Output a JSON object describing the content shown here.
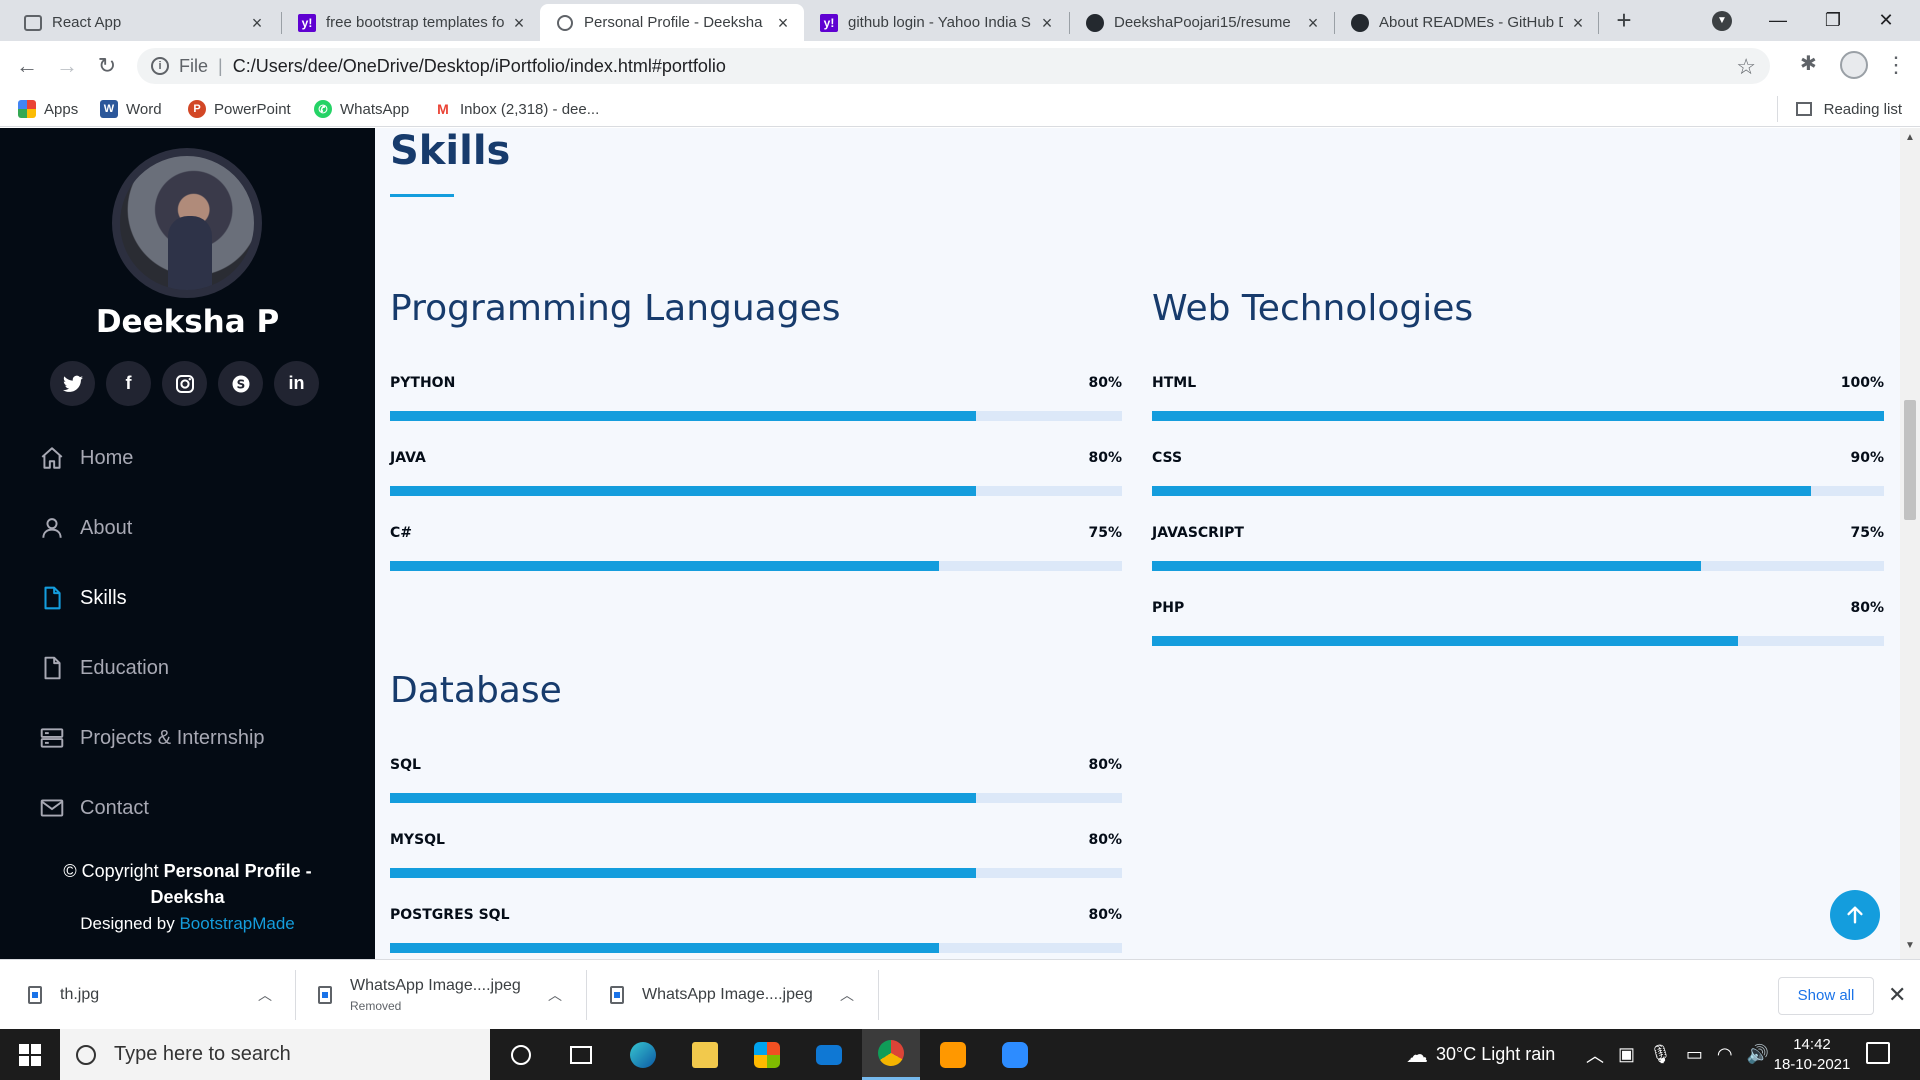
{
  "browser": {
    "tabs": [
      {
        "title": "React App",
        "icon": "react-icon",
        "active": false
      },
      {
        "title": "free bootstrap templates fo",
        "icon": "yahoo-icon",
        "active": false
      },
      {
        "title": "Personal Profile - Deeksha",
        "icon": "globe-icon",
        "active": true
      },
      {
        "title": "github login - Yahoo India S",
        "icon": "yahoo-icon",
        "active": false
      },
      {
        "title": "DeekshaPoojari15/resume",
        "icon": "github-icon",
        "active": false
      },
      {
        "title": "About READMEs - GitHub D",
        "icon": "github-icon",
        "active": false
      }
    ],
    "address": {
      "scheme": "File",
      "url": "C:/Users/dee/OneDrive/Desktop/iPortfolio/index.html#portfolio"
    },
    "bookmarks": [
      {
        "label": "Apps",
        "icon": "apps-grid-icon",
        "color": "#ea4335"
      },
      {
        "label": "Word",
        "icon": "word-icon",
        "color": "#2b579a"
      },
      {
        "label": "PowerPoint",
        "icon": "powerpoint-icon",
        "color": "#d24726"
      },
      {
        "label": "WhatsApp",
        "icon": "whatsapp-icon",
        "color": "#25d366"
      },
      {
        "label": "Inbox (2,318) - dee...",
        "icon": "gmail-icon",
        "color": "#ea4335"
      }
    ],
    "reading_list": "Reading list"
  },
  "sidebar": {
    "name": "Deeksha P",
    "socials": [
      {
        "icon": "twitter-icon",
        "glyph": "🐦"
      },
      {
        "icon": "facebook-icon",
        "glyph": "f"
      },
      {
        "icon": "instagram-icon",
        "glyph": "◎"
      },
      {
        "icon": "skype-icon",
        "glyph": "S"
      },
      {
        "icon": "linkedin-icon",
        "glyph": "in"
      }
    ],
    "nav": [
      {
        "label": "Home",
        "icon": "home-icon",
        "active": false
      },
      {
        "label": "About",
        "icon": "user-icon",
        "active": false
      },
      {
        "label": "Skills",
        "icon": "file-icon",
        "active": true
      },
      {
        "label": "Education",
        "icon": "file-icon",
        "active": false
      },
      {
        "label": "Projects & Internship",
        "icon": "server-icon",
        "active": false
      },
      {
        "label": "Contact",
        "icon": "envelope-icon",
        "active": false
      }
    ],
    "copyright_prefix": "© Copyright ",
    "copyright_bold": "Personal Profile - Deeksha",
    "designed_prefix": "Designed by ",
    "designed_link": "BootstrapMade"
  },
  "main": {
    "section_title": "Skills",
    "groups": [
      {
        "title": "Programming Languages",
        "skills": [
          {
            "name": "PYTHON",
            "percent": "80%",
            "value": 80
          },
          {
            "name": "JAVA",
            "percent": "80%",
            "value": 80
          },
          {
            "name": "C#",
            "percent": "75%",
            "value": 75
          }
        ]
      },
      {
        "title": "Web Technologies",
        "skills": [
          {
            "name": "HTML",
            "percent": "100%",
            "value": 100
          },
          {
            "name": "CSS",
            "percent": "90%",
            "value": 90
          },
          {
            "name": "JAVASCRIPT",
            "percent": "75%",
            "value": 75
          },
          {
            "name": "PHP",
            "percent": "80%",
            "value": 80
          }
        ]
      },
      {
        "title": "Database",
        "skills": [
          {
            "name": "SQL",
            "percent": "80%",
            "value": 80
          },
          {
            "name": "MYSQL",
            "percent": "80%",
            "value": 80
          },
          {
            "name": "POSTGRES SQL",
            "percent": "80%",
            "value": 75
          }
        ]
      }
    ]
  },
  "downloads": [
    {
      "name": "th.jpg",
      "status": ""
    },
    {
      "name": "WhatsApp Image....jpeg",
      "status": "Removed"
    },
    {
      "name": "WhatsApp Image....jpeg",
      "status": ""
    }
  ],
  "downloads_show_all": "Show all",
  "taskbar": {
    "search_placeholder": "Type here to search",
    "weather": "30°C  Light rain",
    "time": "14:42",
    "date": "18-10-2021"
  },
  "colors": {
    "accent": "#149ddd",
    "sidebar_bg": "#040b14",
    "heading": "#173b6c",
    "track": "#dce8f8"
  }
}
